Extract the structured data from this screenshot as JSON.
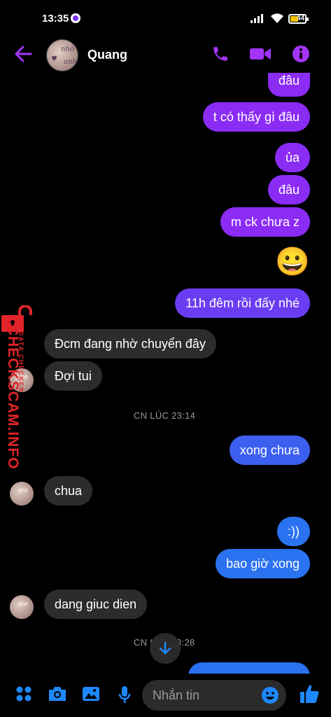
{
  "status_bar": {
    "time": "13:35",
    "battery": "44"
  },
  "header": {
    "contact_name": "Quang"
  },
  "messages": [
    {
      "dir": "out",
      "text": "đâu"
    },
    {
      "dir": "out",
      "text": "t có thấy gì đâu"
    },
    {
      "dir": "out",
      "text": "ủa"
    },
    {
      "dir": "out",
      "text": "đâu"
    },
    {
      "dir": "out",
      "text": "m ck chưa z"
    },
    {
      "dir": "out",
      "text": "😀"
    },
    {
      "dir": "out",
      "text": "11h đêm rồi đấy nhé"
    },
    {
      "dir": "in",
      "text": "Đcm đang nhờ chuyển đây"
    },
    {
      "dir": "in",
      "text": "Đợi tui"
    },
    {
      "dir": "out",
      "text": "xong chưa"
    },
    {
      "dir": "in",
      "text": "chua"
    },
    {
      "dir": "out",
      "text": ":))"
    },
    {
      "dir": "out",
      "text": "bao giờ xong"
    },
    {
      "dir": "in",
      "text": "dang giuc dien"
    }
  ],
  "timestamps": [
    "CN LÚC 23:14",
    "CN L",
    "3:28"
  ],
  "watermark": {
    "site": "CHECKSCAM.INFO",
    "tag": "DATA CHECKER"
  },
  "composer": {
    "placeholder": "Nhắn tin"
  },
  "colors": {
    "accent": "#8b2cf5",
    "blue": "#2a72f0",
    "icon": "#a334fa",
    "composer_icon": "#1e88ff"
  }
}
